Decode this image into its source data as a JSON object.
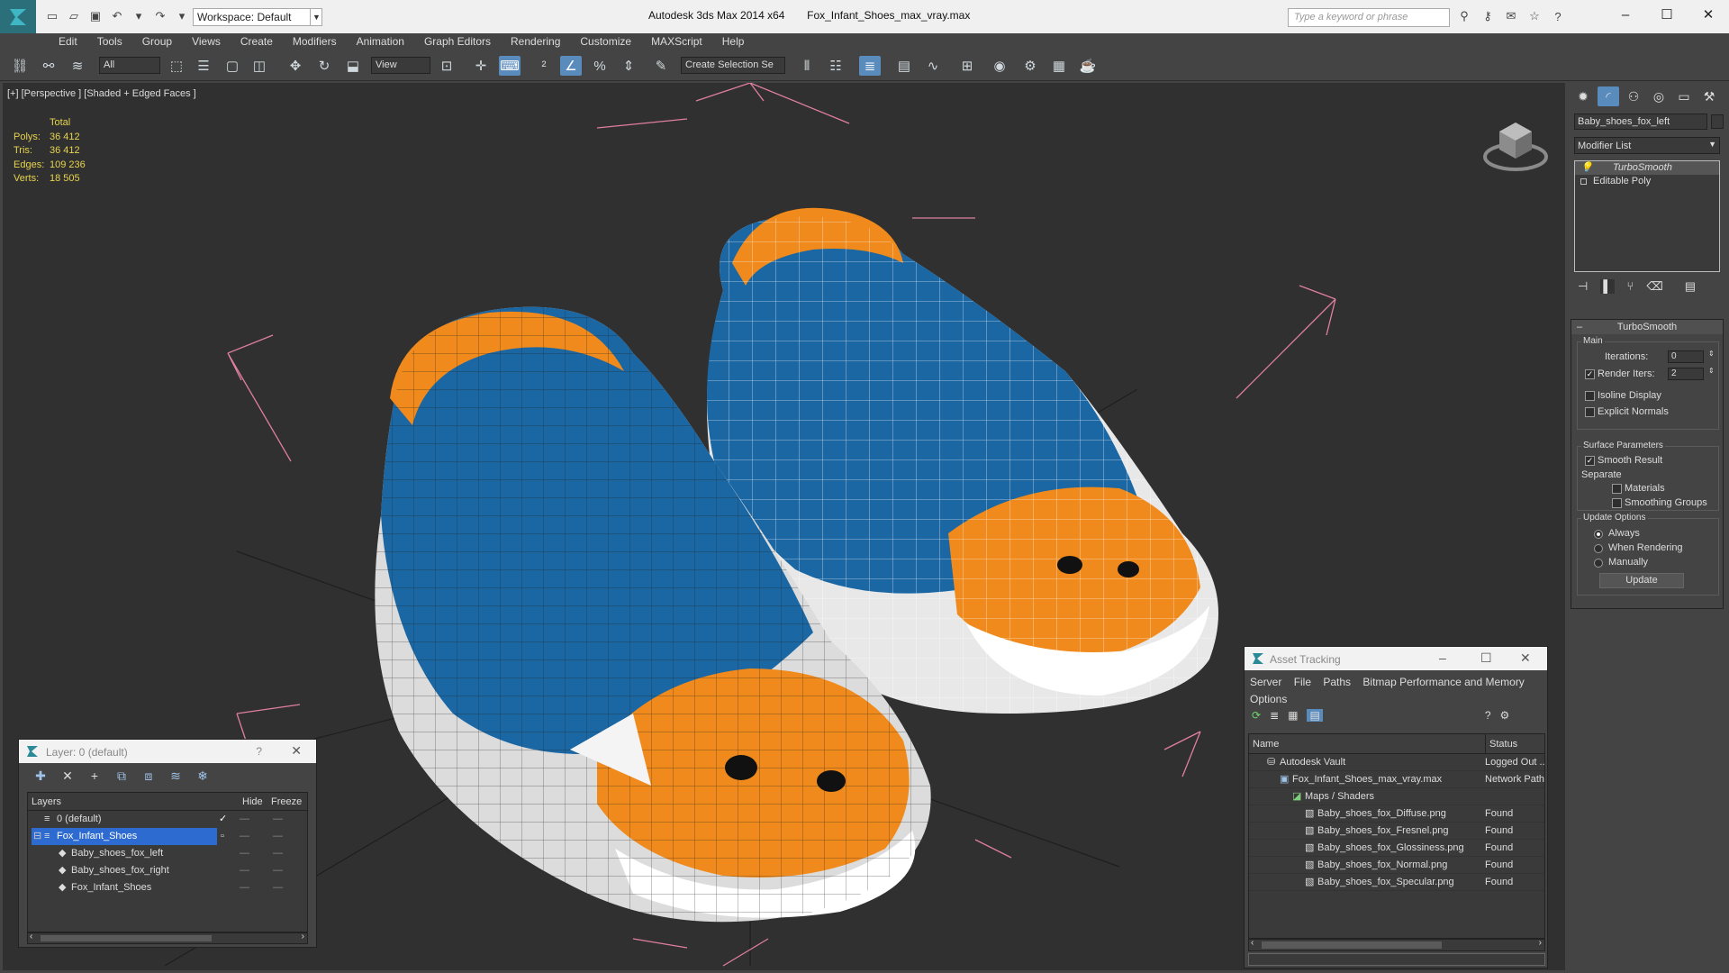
{
  "title_bar": {
    "app_title": "Autodesk 3ds Max  2014 x64",
    "file_name": "Fox_Infant_Shoes_max_vray.max",
    "workspace": "Workspace: Default",
    "search_placeholder": "Type a keyword or phrase"
  },
  "menu": [
    "Edit",
    "Tools",
    "Group",
    "Views",
    "Create",
    "Modifiers",
    "Animation",
    "Graph Editors",
    "Rendering",
    "Customize",
    "MAXScript",
    "Help"
  ],
  "toolbar": {
    "selection_filter": "All",
    "ref_coord": "View",
    "named_selection": "Create Selection Se"
  },
  "viewport": {
    "label": "[+] [Perspective ] [Shaded + Edged Faces ]",
    "stats_header": "Total",
    "stats": [
      {
        "label": "Polys:",
        "value": "36 412"
      },
      {
        "label": "Tris:",
        "value": "36 412"
      },
      {
        "label": "Edges:",
        "value": "109 236"
      },
      {
        "label": "Verts:",
        "value": "18 505"
      }
    ]
  },
  "layer_panel": {
    "title": "Layer: 0 (default)",
    "help": "?",
    "columns": {
      "layers": "Layers",
      "hide": "Hide",
      "freeze": "Freeze"
    },
    "rows": [
      {
        "name": "0 (default)"
      },
      {
        "name": "Fox_Infant_Shoes"
      },
      {
        "name": "Baby_shoes_fox_left"
      },
      {
        "name": "Baby_shoes_fox_right"
      },
      {
        "name": "Fox_Infant_Shoes"
      }
    ]
  },
  "asset_panel": {
    "title": "Asset Tracking",
    "menu": [
      "Server",
      "File",
      "Paths",
      "Bitmap Performance and Memory",
      "Options"
    ],
    "columns": {
      "name": "Name",
      "status": "Status"
    },
    "rows": [
      {
        "name": "Autodesk Vault",
        "status": "Logged Out ..."
      },
      {
        "name": "Fox_Infant_Shoes_max_vray.max",
        "status": "Network Path"
      },
      {
        "name": "Maps / Shaders",
        "status": ""
      },
      {
        "name": "Baby_shoes_fox_Diffuse.png",
        "status": "Found"
      },
      {
        "name": "Baby_shoes_fox_Fresnel.png",
        "status": "Found"
      },
      {
        "name": "Baby_shoes_fox_Glossiness.png",
        "status": "Found"
      },
      {
        "name": "Baby_shoes_fox_Normal.png",
        "status": "Found"
      },
      {
        "name": "Baby_shoes_fox_Specular.png",
        "status": "Found"
      }
    ]
  },
  "command_panel": {
    "object_name": "Baby_shoes_fox_left",
    "modifier_list": "Modifier List",
    "stack": [
      "TurboSmooth",
      "Editable Poly"
    ],
    "rollout_title": "TurboSmooth",
    "main_group": "Main",
    "iterations_label": "Iterations:",
    "iterations_value": "0",
    "render_iters_label": "Render Iters:",
    "render_iters_value": "2",
    "isoline_label": "Isoline Display",
    "explicit_normals_label": "Explicit Normals",
    "surface_group": "Surface Parameters",
    "smooth_result_label": "Smooth Result",
    "separate_label": "Separate",
    "materials_label": "Materials",
    "smoothing_groups_label": "Smoothing Groups",
    "update_group": "Update Options",
    "always_label": "Always",
    "when_rendering_label": "When Rendering",
    "manually_label": "Manually",
    "update_button": "Update"
  },
  "colors": {
    "accent": "#5a8bbd",
    "stats_text": "#e8d44d",
    "shoe_blue": "#1b67a3",
    "shoe_orange": "#f08a1c",
    "sole_white": "#e8e8e8",
    "bbox_pink": "#e07fa0"
  }
}
